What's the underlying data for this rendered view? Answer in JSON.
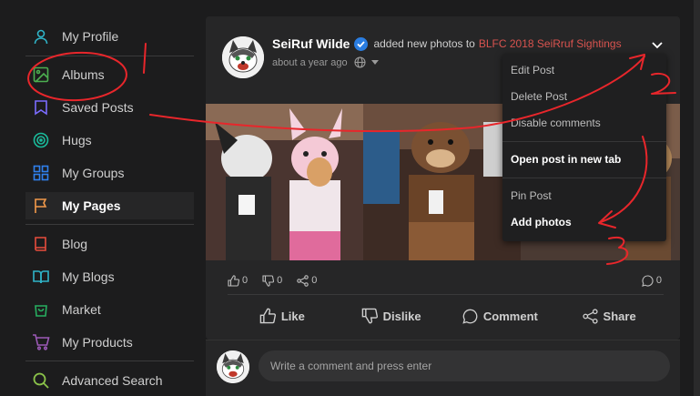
{
  "sidebar": {
    "items": [
      {
        "label": "My Profile",
        "icon": "user-icon",
        "color": "#2fb4c8"
      },
      {
        "label": "Albums",
        "icon": "image-icon",
        "color": "#4caf50"
      },
      {
        "label": "Saved Posts",
        "icon": "bookmark-icon",
        "color": "#6c63ff"
      },
      {
        "label": "Hugs",
        "icon": "target-icon",
        "color": "#1abc9c"
      },
      {
        "label": "My Groups",
        "icon": "grid-icon",
        "color": "#2f80ed"
      },
      {
        "label": "My Pages",
        "icon": "flag-icon",
        "color": "#f2994a"
      },
      {
        "label": "Blog",
        "icon": "book-icon",
        "color": "#e74c3c"
      },
      {
        "label": "My Blogs",
        "icon": "open-book-icon",
        "color": "#2fb4c8"
      },
      {
        "label": "Market",
        "icon": "bag-icon",
        "color": "#27ae60"
      },
      {
        "label": "My Products",
        "icon": "cart-icon",
        "color": "#9b59b6"
      },
      {
        "label": "Advanced Search",
        "icon": "search-icon",
        "color": "#8bc34a"
      }
    ]
  },
  "post": {
    "author": "SeiRuf Wilde",
    "action": "added new photos to",
    "album": "BLFC 2018 SeiRruf Sightings",
    "time": "about a year ago",
    "reactions": {
      "likes": "0",
      "dislikes": "0",
      "shares": "0",
      "comments": "0"
    },
    "actions": {
      "like": "Like",
      "dislike": "Dislike",
      "comment": "Comment",
      "share": "Share"
    }
  },
  "menu": {
    "items": [
      {
        "label": "Edit Post",
        "bold": false
      },
      {
        "label": "Delete Post",
        "bold": false
      },
      {
        "label": "Disable comments",
        "bold": false
      },
      {
        "label": "Open post in new tab",
        "bold": true
      },
      {
        "label": "Pin Post",
        "bold": false
      },
      {
        "label": "Add photos",
        "bold": true
      }
    ]
  },
  "comment": {
    "placeholder": "Write a comment and press enter"
  },
  "annotations": {
    "n1": "1",
    "n2": "2",
    "n3": "3",
    "color": "#e8262b"
  }
}
